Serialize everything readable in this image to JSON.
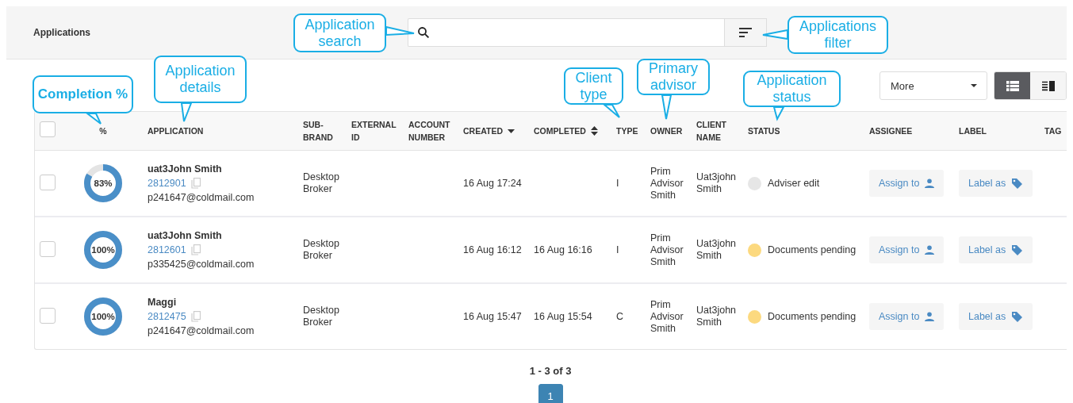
{
  "header": {
    "title": "Applications"
  },
  "toolbar": {
    "more_dropdown": "More",
    "view_toggle": [
      {
        "kind": "list",
        "selected": true
      },
      {
        "kind": "split",
        "selected": false
      }
    ]
  },
  "table": {
    "select_all": {
      "checked": false
    },
    "columns": [
      {
        "label": "%",
        "kind": "plain"
      },
      {
        "label": "APPLICATION",
        "kind": "plain"
      },
      {
        "label": "SUB-BRAND",
        "kind": "plain"
      },
      {
        "label": "EXTERNAL ID",
        "kind": "plain"
      },
      {
        "label": "ACCOUNT NUMBER",
        "kind": "plain"
      },
      {
        "label": "CREATED",
        "kind": "descending"
      },
      {
        "label": "COMPLETED",
        "kind": "sortable"
      },
      {
        "label": "TYPE",
        "kind": "plain"
      },
      {
        "label": "OWNER",
        "kind": "plain"
      },
      {
        "label": "CLIENT NAME",
        "kind": "plain"
      },
      {
        "label": "STATUS",
        "kind": "plain"
      },
      {
        "label": "ASSIGNEE",
        "kind": "plain"
      },
      {
        "label": "LABEL",
        "kind": "plain"
      },
      {
        "label": "TAG",
        "kind": "plain"
      }
    ],
    "rows": [
      {
        "checked": false,
        "level": 0.83,
        "percent": "83%",
        "name": "uat3John Smith",
        "id": "2812901",
        "email": "p241647@coldmail.com",
        "sub_brand": "Desktop Broker",
        "created": "16 Aug 17:24",
        "type": "I",
        "owner": "Prim Advisor Smith",
        "client_name": "Uat3john Smith",
        "status": {
          "label": "Adviser edit",
          "color": "#e6e6e6"
        },
        "assign_button": "Assign to",
        "label_button": "Label as"
      },
      {
        "checked": false,
        "level": 1,
        "percent": "100%",
        "name": "uat3John Smith",
        "id": "2812601",
        "email": "p335425@coldmail.com",
        "sub_brand": "Desktop Broker",
        "created": "16 Aug 16:12",
        "completed": "16 Aug 16:16",
        "type": "I",
        "owner": "Prim Advisor Smith",
        "client_name": "Uat3john Smith",
        "status": {
          "label": "Documents pending",
          "color": "#fcd97f"
        },
        "assign_button": "Assign to",
        "label_button": "Label as"
      },
      {
        "checked": false,
        "level": 1,
        "percent": "100%",
        "name": "Maggi",
        "id": "2812475",
        "email": "p241647@coldmail.com",
        "sub_brand": "Desktop Broker",
        "created": "16 Aug 15:47",
        "completed": "16 Aug 15:54",
        "type": "C",
        "owner": "Prim Advisor Smith",
        "client_name": "Uat3john Smith",
        "status": {
          "label": "Documents pending",
          "color": "#fcd97f"
        },
        "assign_button": "Assign to",
        "label_button": "Label as"
      }
    ]
  },
  "pagination": {
    "summary": "1 - 3 of 3",
    "pages": [
      {
        "label": "1",
        "selected": true
      }
    ]
  },
  "callouts": [
    {
      "text": "Application search",
      "bold": false
    },
    {
      "text": "Applications filter",
      "bold": false
    },
    {
      "text": "Completion %",
      "bold": true
    },
    {
      "text": "Application details",
      "bold": false
    },
    {
      "text": "Client type",
      "bold": false
    },
    {
      "text": "Primary advisor",
      "bold": false
    },
    {
      "text": "Application status",
      "bold": false
    }
  ]
}
